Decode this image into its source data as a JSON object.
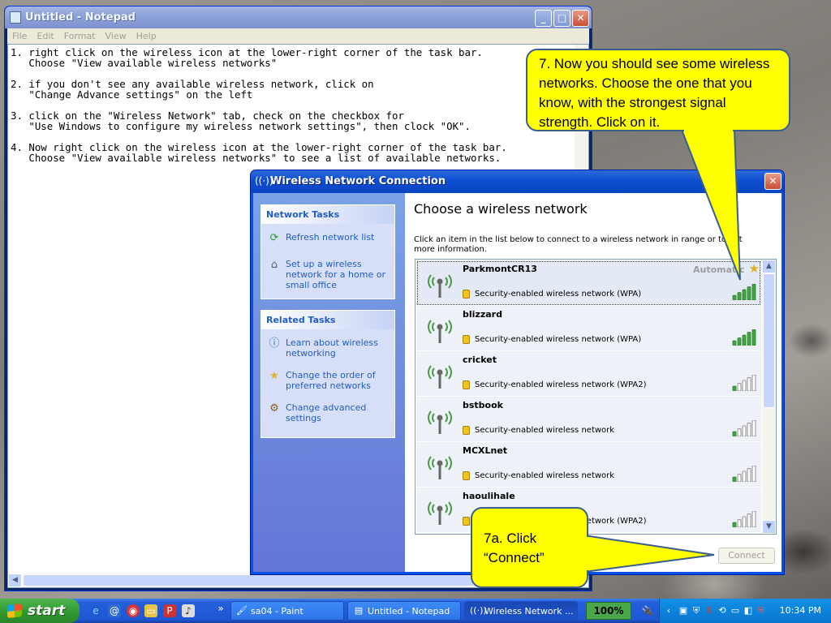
{
  "notepad": {
    "title": "Untitled - Notepad",
    "menu": [
      "File",
      "Edit",
      "Format",
      "View",
      "Help"
    ],
    "content": "1. right click on the wireless icon at the lower-right corner of the task bar.\n   Choose \"View available wireless networks\"\n\n2. if you don't see any available wireless network, click on\n   \"Change Advance settings\" on the left\n\n3. click on the \"Wireless Network\" tab, check on the checkbox for\n   \"Use Windows to configure my wireless network settings\", then clock \"OK\".\n\n4. Now right click on the wireless icon at the lower-right corner of the task bar.\n   Choose \"View available wireless networks\" to see a list of available networks."
  },
  "dialog": {
    "title": "Wireless Network Connection",
    "heading": "Choose a wireless network",
    "description": "Click an item in the list below to connect to a wireless network in range or to get more information.",
    "network_tasks": {
      "header": "Network Tasks",
      "items": [
        "Refresh network list",
        "Set up a wireless network for a home or small office"
      ]
    },
    "related_tasks": {
      "header": "Related Tasks",
      "items": [
        "Learn about wireless networking",
        "Change the order of preferred networks",
        "Change advanced settings"
      ]
    },
    "networks": [
      {
        "ssid": "ParkmontCR13",
        "status": "Automatic",
        "security": "Security-enabled wireless network (WPA)",
        "signal": 5,
        "preferred": true
      },
      {
        "ssid": "blizzard",
        "status": "",
        "security": "Security-enabled wireless network (WPA)",
        "signal": 5,
        "preferred": false
      },
      {
        "ssid": "cricket",
        "status": "",
        "security": "Security-enabled wireless network (WPA2)",
        "signal": 1,
        "preferred": false
      },
      {
        "ssid": "bstbook",
        "status": "",
        "security": "Security-enabled wireless network",
        "signal": 1,
        "preferred": false
      },
      {
        "ssid": "MCXLnet",
        "status": "",
        "security": "Security-enabled wireless network",
        "signal": 1,
        "preferred": false
      },
      {
        "ssid": "haoulihale",
        "status": "",
        "security": "Security-enabled wireless network (WPA2)",
        "signal": 1,
        "preferred": false
      }
    ],
    "connect_label": "Connect"
  },
  "callouts": {
    "step7": "7. Now you should see some wireless networks. Choose the one that you know, with the strongest signal strength. Click on it.",
    "step7a_line1": "7a. Click",
    "step7a_line2": "“Connect”"
  },
  "taskbar": {
    "start_label": "start",
    "tasks": [
      {
        "label": "sa04 - Paint"
      },
      {
        "label": "Untitled - Notepad"
      },
      {
        "label": "Wireless Network ..."
      }
    ],
    "zoom": "100%",
    "clock": "10:34 PM"
  },
  "colors": {
    "accent_blue": "#0054e3",
    "callout_yellow": "#ffff00",
    "signal_green": "#3ea83e",
    "link_blue": "#215dc6"
  }
}
